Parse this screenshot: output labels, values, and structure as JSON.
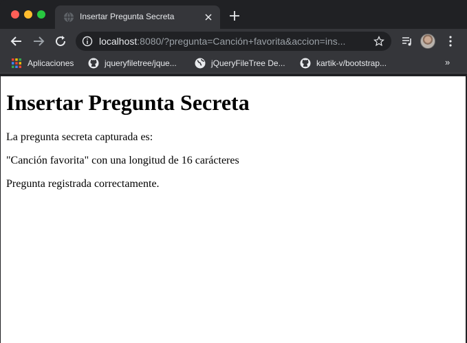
{
  "browser": {
    "tab": {
      "title": "Insertar Pregunta Secreta"
    },
    "address": {
      "host": "localhost",
      "rest": ":8080/?pregunta=Canción+favorita&accion=ins..."
    },
    "bookmarks": [
      {
        "label": "Aplicaciones",
        "icon": "apps-grid-icon"
      },
      {
        "label": "jqueryfiletree/jque...",
        "icon": "github-icon"
      },
      {
        "label": "jQueryFileTree De...",
        "icon": "globe-icon"
      },
      {
        "label": "kartik-v/bootstrap...",
        "icon": "github-icon"
      }
    ],
    "bookmarks_overflow": "»",
    "colors": {
      "chrome_dark": "#202124",
      "chrome_toolbar": "#35363a",
      "traffic_red": "#ff5f57",
      "traffic_yellow": "#febc2e",
      "traffic_green": "#28c840"
    }
  },
  "page": {
    "heading": "Insertar Pregunta Secreta",
    "lines": [
      "La pregunta secreta capturada es:",
      "\"Canción favorita\" con una longitud de 16 carácteres",
      "Pregunta registrada correctamente."
    ]
  }
}
